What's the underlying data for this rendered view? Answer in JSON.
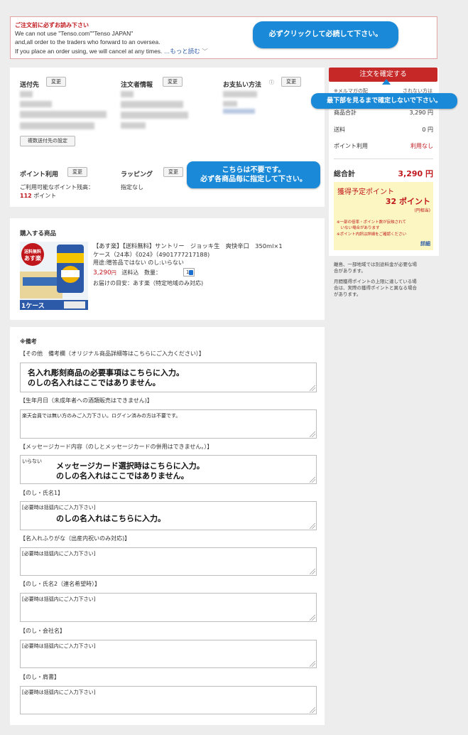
{
  "notice": {
    "title": "ご注文前に必ずお読み下さい",
    "line1": "We can not use \"Tenso.com\"\"Tenso JAPAN\"",
    "line2": "and,all order to the traders who forward to an oversea.",
    "line3": "If you place an order using, we will cancel at any times.",
    "more_link": "…もっと読む",
    "bubble": "必ずクリックして必読して下さい。"
  },
  "shipping": {
    "destination_label": "送付先",
    "orderer_label": "注文者情報",
    "payment_label": "お支払い方法",
    "change_label": "変更",
    "multi_destination_button": "複数送付先の設定"
  },
  "points": {
    "label": "ポイント利用",
    "change_label": "変更",
    "available_text": "ご利用可能なポイント残高：",
    "balance": "112",
    "unit": "ポイント"
  },
  "wrapping": {
    "label": "ラッピング",
    "change_label": "変更",
    "value": "指定なし",
    "bubble_line1": "こちらは不要です。",
    "bubble_line2": "必ず各商品毎に指定して下さい。"
  },
  "product": {
    "section_title": "購入する商品",
    "name_line1": "【あす楽】【送料無料】サントリー　ジョッキ生　爽快辛口　350ml×1",
    "name_line2": "ケース（24本）《024》（4901777217188)",
    "purpose": "用途:贈答品ではない のし:いらない",
    "price": "3,290",
    "price_unit": "円",
    "shipping_note": "送料込",
    "qty_label": "数量：",
    "qty_value": "1",
    "delivery": "お届けの目安：あす楽（特定地域のみ対応)",
    "badge_line1": "送料無料",
    "badge_line2": "あす楽",
    "case_label": "1ケース"
  },
  "notes": {
    "title": "※備考",
    "fields": [
      {
        "label": "【その他　備考欄（オリジナル商品詳細等はこちらにご入力ください）】",
        "value": "",
        "overlay1": "名入れ彫刻商品の必要事項はこちらに入力。",
        "overlay2": "のしの名入れはここではありません。"
      },
      {
        "label": "【生年月日（未成年者への酒類販売はできません)】",
        "value": "楽天会員では無い方のみご入力下さい。ログイン済みの方は不要です。",
        "overlay1": "",
        "overlay2": ""
      },
      {
        "label": "【メッセージカード内容（のしとメッセージカードの併用はできません。）】",
        "value": "いらない",
        "overlay1": "メッセージカード選択時はこちらに入力。",
        "overlay2": "のしの名入れはここではありません。"
      },
      {
        "label": "【のし・氏名1】",
        "value": "[必要時は括弧内にご入力下さい]",
        "overlay1": "のしの名入れはこちらに入力。",
        "overlay2": ""
      },
      {
        "label": "【名入れふりがな（出産内祝いのみ対応)】",
        "value": "[必要時は括弧内にご入力下さい]",
        "overlay1": "",
        "overlay2": ""
      },
      {
        "label": "【のし・氏名2（連名希望時）】",
        "value": "[必要時は括弧内にご入力下さい]",
        "overlay1": "",
        "overlay2": ""
      },
      {
        "label": "【のし・会社名】",
        "value": "[必要時は括弧内にご入力下さい]",
        "overlay1": "",
        "overlay2": ""
      },
      {
        "label": "【のし・肩書】",
        "value": "[必要時は括弧内にご入力下さい]",
        "overlay1": "",
        "overlay2": ""
      }
    ]
  },
  "summary": {
    "confirm_button": "注文を確定する",
    "bubble": "最下部を見るまで確定しないで下さい。",
    "mailmag_note": "※メルマガの配",
    "mailmag_note2": "されない方は",
    "subtotal_label": "商品合計",
    "subtotal_value": "3,290 円",
    "shipping_label": "送料",
    "shipping_value": "0 円",
    "points_label": "ポイント利用",
    "points_value": "利用なし",
    "total_label": "総合計",
    "total_value": "3,290 円",
    "earn_title": "獲得予定ポイント",
    "earn_value": "32 ポイント",
    "earn_sub": "(円相当)",
    "earn_note1": "※一部の倍率・ポイント数が反映されて",
    "earn_note2": "　いない場合があります",
    "earn_note3": "※ポイント内訳は詳細をご確認ください",
    "detail_link": "詳細",
    "island_note1": "離島、一部地域では別途料金が必要な場",
    "island_note2": "合があります。",
    "limit_note1": "月間獲得ポイントの上限に達している場",
    "limit_note2": "合は、実際の獲得ポイントと異なる場合",
    "limit_note3": "があります。"
  }
}
